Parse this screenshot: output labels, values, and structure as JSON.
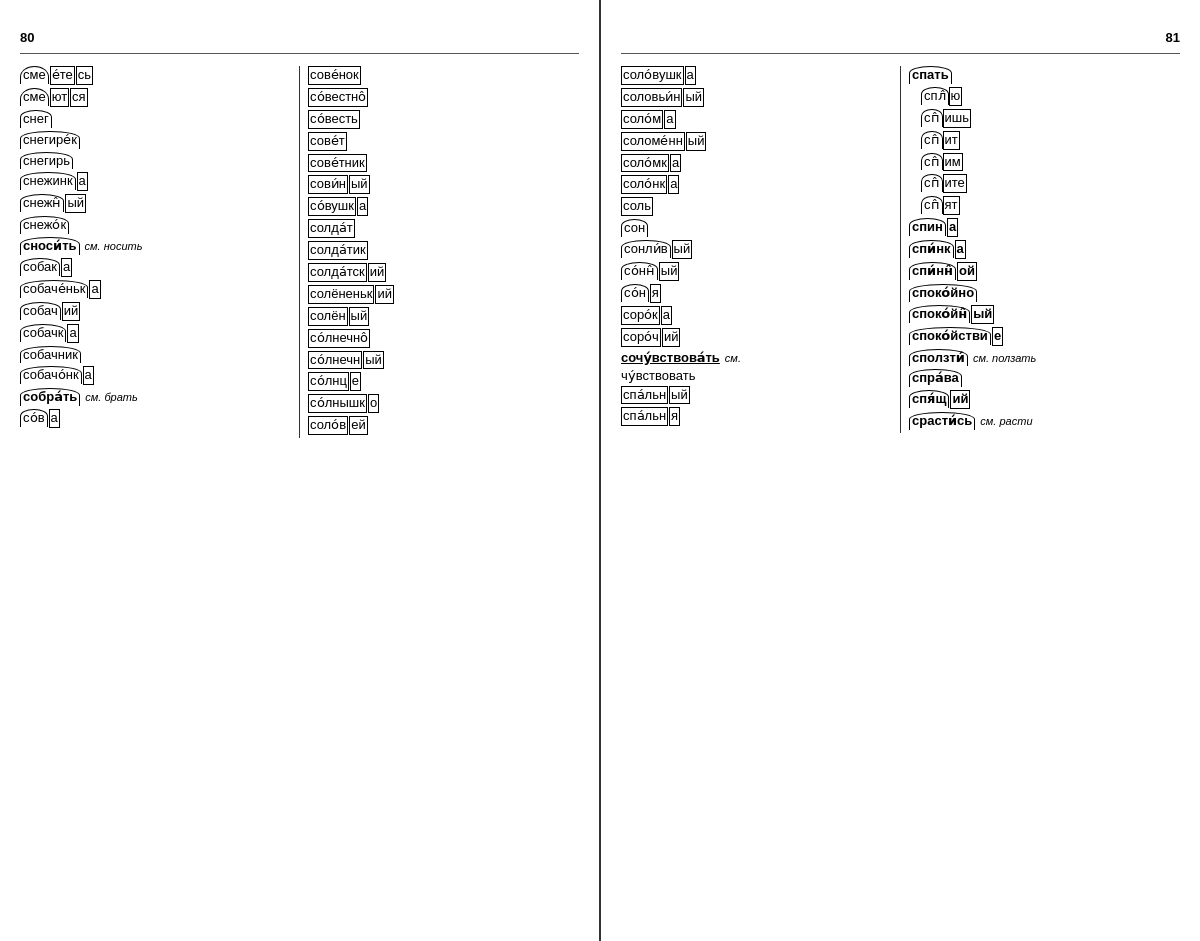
{
  "pages": {
    "left": {
      "number": "80",
      "col1": [
        {
          "display": "сме|ете|сь",
          "type": "arc-box-box"
        },
        {
          "display": "сме|ют|ся",
          "type": "arc-box-box"
        },
        {
          "display": "снег",
          "type": "arc"
        },
        {
          "display": "снегире́к",
          "type": "arc"
        },
        {
          "display": "снегирь",
          "type": "arc"
        },
        {
          "display": "снежинк|а",
          "type": "arc-box"
        },
        {
          "display": "снежн|ый",
          "type": "arc-box"
        },
        {
          "display": "снежо́к",
          "type": "arc"
        },
        {
          "display": "сноси́ть",
          "type": "arc-bold",
          "ref": "см. носить"
        },
        {
          "display": "собак|а",
          "type": "arc-box"
        },
        {
          "display": "собаче́ньк|а",
          "type": "arc-box"
        },
        {
          "display": "собач|ий",
          "type": "arc-box"
        },
        {
          "display": "собачк|а",
          "type": "arc-box"
        },
        {
          "display": "собачник",
          "type": "arc"
        },
        {
          "display": "собачо́нк|а",
          "type": "arc-box"
        },
        {
          "display": "собра́ть",
          "type": "arc-bold",
          "ref": "см. брать"
        },
        {
          "display": "сов|а",
          "type": "arc-box"
        }
      ],
      "col2": [
        {
          "display": "сове́нок",
          "type": "box-full"
        },
        {
          "display": "со́вестно",
          "type": "box-full",
          "dstress": true
        },
        {
          "display": "со́весть",
          "type": "box-full"
        },
        {
          "display": "сове́т",
          "type": "box-full"
        },
        {
          "display": "сове́тник",
          "type": "box-full"
        },
        {
          "display": "сови́н|ый",
          "type": "box-box"
        },
        {
          "display": "со́вушк|а",
          "type": "box-box"
        },
        {
          "display": "солда́т",
          "type": "box-full"
        },
        {
          "display": "солда́тик",
          "type": "box-full"
        },
        {
          "display": "солда́тск|ий",
          "type": "box-box"
        },
        {
          "display": "солёненьк|ий",
          "type": "box-box"
        },
        {
          "display": "солён|ый",
          "type": "box-box"
        },
        {
          "display": "со́лнечно",
          "type": "box-full",
          "dstress": true
        },
        {
          "display": "со́лнечн|ый",
          "type": "box-box"
        },
        {
          "display": "со́лнц|е",
          "type": "box-box"
        },
        {
          "display": "со́лнышк|о",
          "type": "box-box"
        },
        {
          "display": "соло́в|ей",
          "type": "box-box"
        }
      ]
    },
    "right": {
      "number": "81",
      "col1": [
        {
          "display": "соло́вушк|а",
          "type": "box-box"
        },
        {
          "display": "соловьи́н|ый",
          "type": "box-box"
        },
        {
          "display": "соло́м|а",
          "type": "box-box"
        },
        {
          "display": "соломе́нн|ый",
          "type": "box-box"
        },
        {
          "display": "соло́мк|а",
          "type": "box-box"
        },
        {
          "display": "соло́нк|а",
          "type": "box-box"
        },
        {
          "display": "соль",
          "type": "box-full"
        },
        {
          "display": "сон",
          "type": "arc"
        },
        {
          "display": "сонли́в|ый",
          "type": "arc-box"
        },
        {
          "display": "со́нн|ый",
          "type": "arc-box"
        },
        {
          "display": "со́н|я",
          "type": "arc-box"
        },
        {
          "display": "соро́к|а",
          "type": "box-box"
        },
        {
          "display": "соро́ч|ий",
          "type": "box-box"
        },
        {
          "display": "сочу́вствова́ть",
          "type": "box-bold",
          "ref": "см."
        },
        {
          "display": "чу́вствовать",
          "type": "plain"
        },
        {
          "display": "спа́льн|ый",
          "type": "box-box"
        },
        {
          "display": "спа́льн|я",
          "type": "box-box"
        }
      ],
      "col2": [
        {
          "display": "спать",
          "type": "arc-bold"
        },
        {
          "display": "спл|ю",
          "type": "arc-box"
        },
        {
          "display": "сп|ишь",
          "type": "arc-box"
        },
        {
          "display": "сп|ит",
          "type": "arc-box"
        },
        {
          "display": "сп|им",
          "type": "arc-box"
        },
        {
          "display": "сп|ите",
          "type": "arc-box"
        },
        {
          "display": "сп|ят",
          "type": "arc-box"
        },
        {
          "display": "спин|а",
          "type": "arc-box"
        },
        {
          "display": "спи́нк|а",
          "type": "arc-box"
        },
        {
          "display": "спи́нн|ой",
          "type": "arc-box"
        },
        {
          "display": "споко́йно",
          "type": "arc"
        },
        {
          "display": "споко́йн|ый",
          "type": "arc-box"
        },
        {
          "display": "споко́йстви|е",
          "type": "arc-box"
        },
        {
          "display": "сползти́",
          "type": "arc-bold",
          "ref": "см. ползать"
        },
        {
          "display": "спра́ва",
          "type": "arc"
        },
        {
          "display": "спя́щ|ий",
          "type": "arc-box"
        },
        {
          "display": "срасти́сь",
          "type": "arc-bold",
          "ref": "см. расти"
        }
      ]
    }
  }
}
